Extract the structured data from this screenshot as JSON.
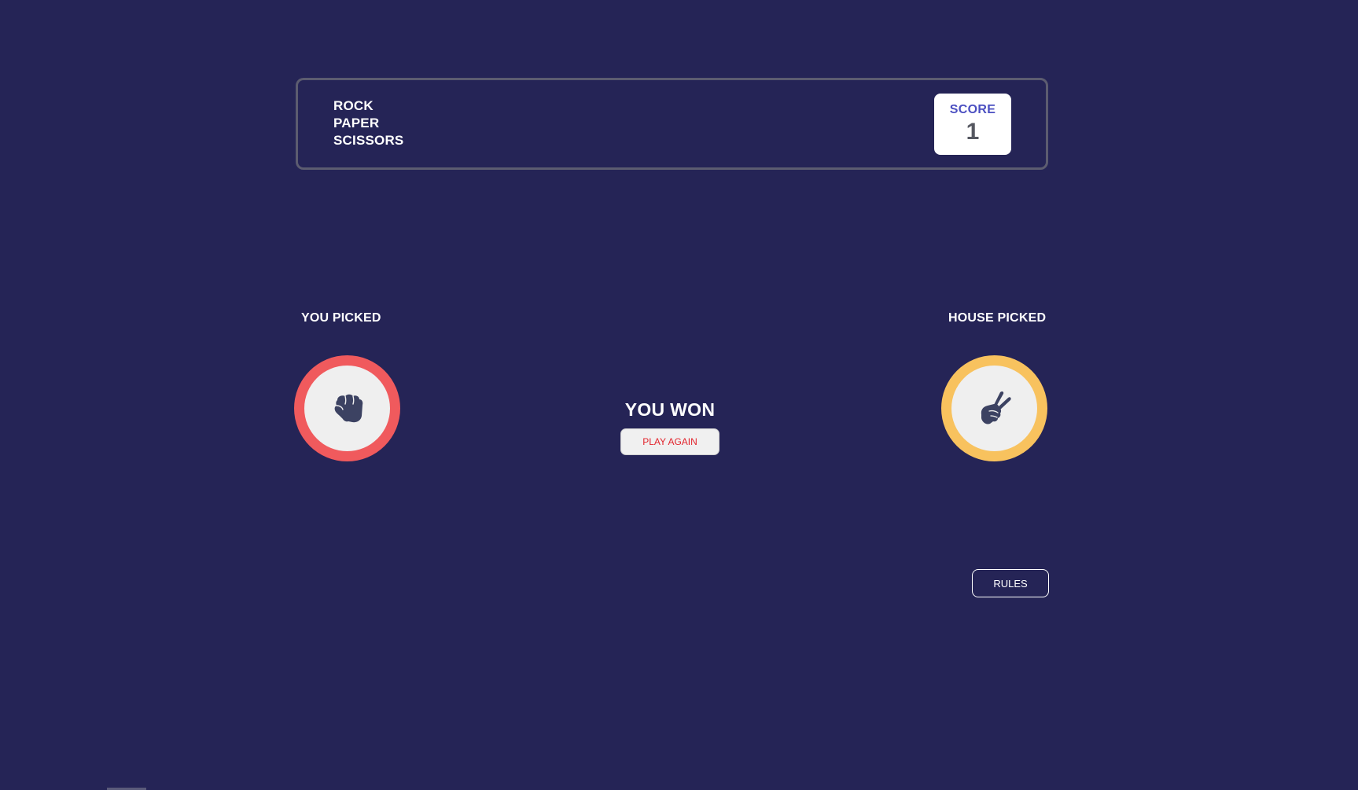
{
  "header": {
    "title_lines": [
      "ROCK",
      "PAPER",
      "SCISSORS"
    ],
    "score_label": "SCORE",
    "score_value": "1"
  },
  "player": {
    "label": "YOU PICKED",
    "choice": "rock",
    "icon": "rock-fist-icon",
    "ring_color": "#f05a5d"
  },
  "house": {
    "label": "HOUSE PICKED",
    "choice": "scissors",
    "icon": "scissors-hand-icon",
    "ring_color": "#f8c25e"
  },
  "result": {
    "text": "YOU WON",
    "play_again_label": "PLAY AGAIN"
  },
  "footer": {
    "rules_label": "RULES"
  },
  "colors": {
    "background": "#252456",
    "score_label": "#4b4fc1",
    "play_again_text": "#e2242c",
    "icon": "#3c4262"
  }
}
